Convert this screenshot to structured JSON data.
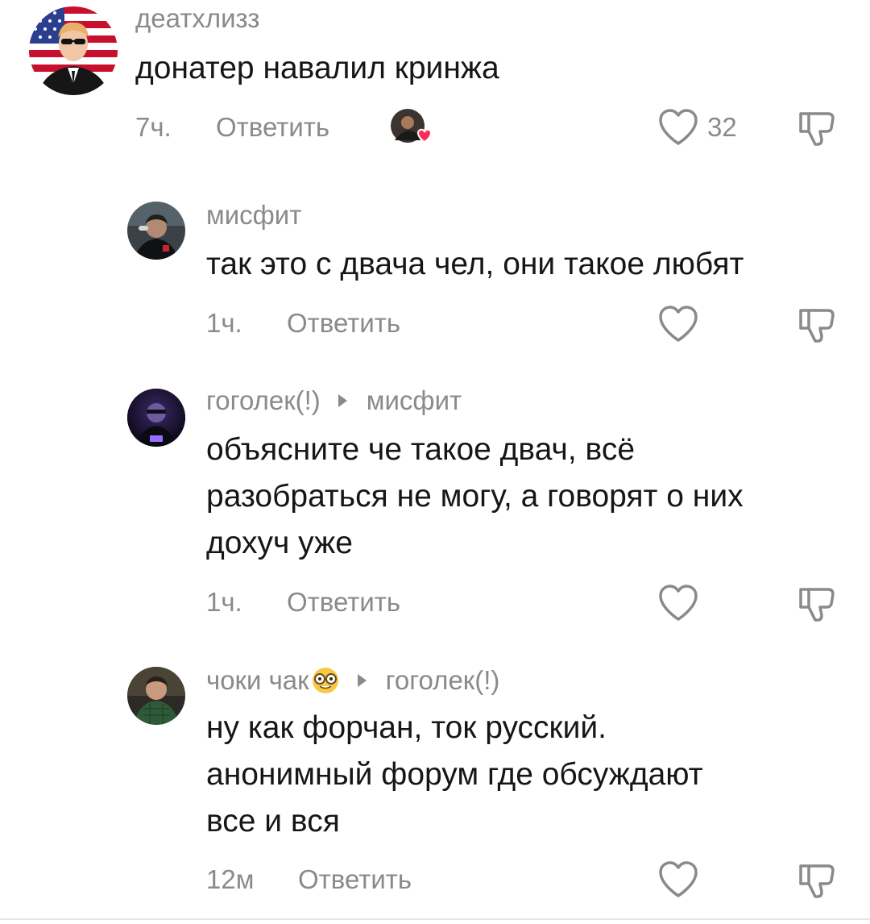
{
  "comments": [
    {
      "username": "деатхлизз",
      "text_lines": [
        "донатер навалил кринжа"
      ],
      "time": "7ч.",
      "reply_label": "Ответить",
      "like_count": "32",
      "creator_liked": true,
      "avatar": "american-flag-sunglasses-avatar"
    },
    {
      "username": "мисфит",
      "text_lines": [
        "так это с двача чел, они такое любят"
      ],
      "time": "1ч.",
      "reply_label": "Ответить",
      "like_count": "",
      "avatar": "dark-photo-avatar"
    },
    {
      "username": "гоголек(!)",
      "reply_to": "мисфит",
      "text_lines": [
        "объясните че такое двач, всё",
        "разобраться не могу, а говорят о них",
        "дохуч уже"
      ],
      "time": "1ч.",
      "reply_label": "Ответить",
      "like_count": "",
      "avatar": "purple-neon-avatar"
    },
    {
      "username": "чоки чак",
      "username_emoji": "nerd-face-emoji",
      "reply_to": "гоголек(!)",
      "text_lines": [
        "ну как форчан, ток русский.",
        "анонимный форум где обсуждают",
        "все и вся"
      ],
      "time": "12м",
      "reply_label": "Ответить",
      "like_count": "",
      "avatar": "green-shirt-avatar"
    }
  ],
  "colors": {
    "text": "#161616",
    "secondary": "#8a8a8a",
    "heart_red": "#fe2c55"
  },
  "icons": {
    "like": "heart-outline-icon",
    "dislike": "thumbs-down-outline-icon",
    "reply_arrow": "triangle-right-icon"
  }
}
